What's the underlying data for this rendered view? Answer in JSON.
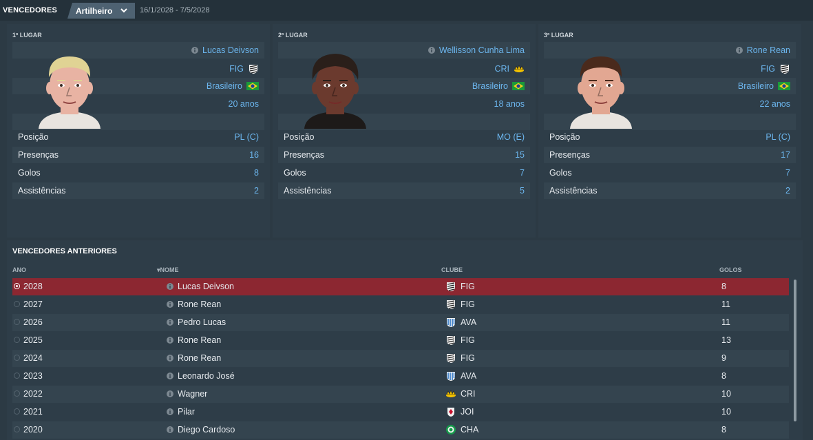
{
  "header": {
    "title": "VENCEDORES",
    "dropdown_label": "Artilheiro",
    "date_range": "16/1/2028 - 7/5/2028"
  },
  "podium": [
    {
      "place": "1º LUGAR",
      "name": "Lucas Deivson",
      "club": "FIG",
      "nationality": "Brasileiro",
      "age": "20 anos",
      "stats": [
        {
          "label": "Posição",
          "value": "PL (C)"
        },
        {
          "label": "Presenças",
          "value": "16"
        },
        {
          "label": "Golos",
          "value": "8"
        },
        {
          "label": "Assistências",
          "value": "2"
        }
      ],
      "hair": "#e0d394",
      "skin": "#e8b3a3"
    },
    {
      "place": "2º LUGAR",
      "name": "Wellisson Cunha Lima",
      "club": "CRI",
      "nationality": "Brasileiro",
      "age": "18 anos",
      "stats": [
        {
          "label": "Posição",
          "value": "MO (E)"
        },
        {
          "label": "Presenças",
          "value": "15"
        },
        {
          "label": "Golos",
          "value": "7"
        },
        {
          "label": "Assistências",
          "value": "5"
        }
      ],
      "hair": "#2a1f1a",
      "skin": "#6b3a2e"
    },
    {
      "place": "3º LUGAR",
      "name": "Rone Rean",
      "club": "FIG",
      "nationality": "Brasileiro",
      "age": "22 anos",
      "stats": [
        {
          "label": "Posição",
          "value": "PL (C)"
        },
        {
          "label": "Presenças",
          "value": "17"
        },
        {
          "label": "Golos",
          "value": "7"
        },
        {
          "label": "Assistências",
          "value": "2"
        }
      ],
      "hair": "#4a2a1c",
      "skin": "#e2a792"
    }
  ],
  "history": {
    "title": "VENCEDORES ANTERIORES",
    "columns": {
      "year": "ANO",
      "name": "NOME",
      "club": "CLUBE",
      "goals": "GOLOS"
    },
    "rows": [
      {
        "year": "2028",
        "name": "Lucas Deivson",
        "club": "FIG",
        "goals": "8"
      },
      {
        "year": "2027",
        "name": "Rone Rean",
        "club": "FIG",
        "goals": "11"
      },
      {
        "year": "2026",
        "name": "Pedro Lucas",
        "club": "AVA",
        "goals": "11"
      },
      {
        "year": "2025",
        "name": "Rone Rean",
        "club": "FIG",
        "goals": "13"
      },
      {
        "year": "2024",
        "name": "Rone Rean",
        "club": "FIG",
        "goals": "9"
      },
      {
        "year": "2023",
        "name": "Leonardo José",
        "club": "AVA",
        "goals": "8"
      },
      {
        "year": "2022",
        "name": "Wagner",
        "club": "CRI",
        "goals": "10"
      },
      {
        "year": "2021",
        "name": "Pilar",
        "club": "JOI",
        "goals": "10"
      },
      {
        "year": "2020",
        "name": "Diego Cardoso",
        "club": "CHA",
        "goals": "8"
      }
    ]
  },
  "colors": {
    "accent": "#6cb6ee",
    "selected_row": "#8c2731",
    "panel": "#2e3d48"
  }
}
